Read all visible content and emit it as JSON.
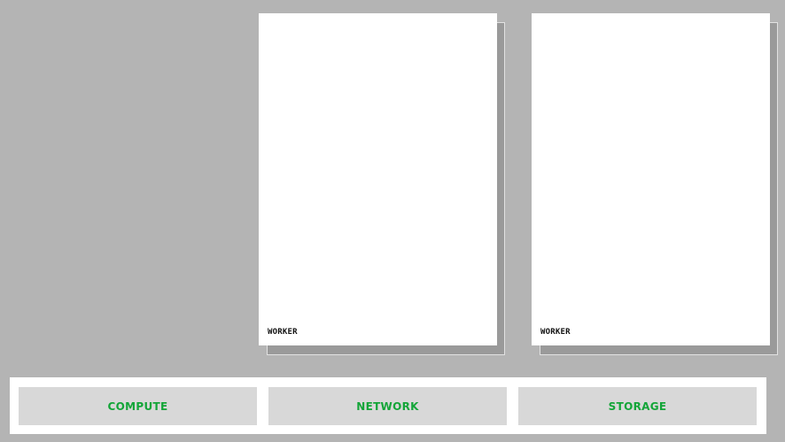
{
  "workers": [
    {
      "label": "WORKER"
    },
    {
      "label": "WORKER"
    }
  ],
  "infrastructure": {
    "compute_label": "COMPUTE",
    "network_label": "NETWORK",
    "storage_label": "STORAGE"
  },
  "colors": {
    "background": "#b4b4b4",
    "card": "#ffffff",
    "card_shadow": "#9a9a9a",
    "infra_box": "#d8d8d8",
    "accent_green": "#13a538",
    "label_dark": "#111111"
  }
}
